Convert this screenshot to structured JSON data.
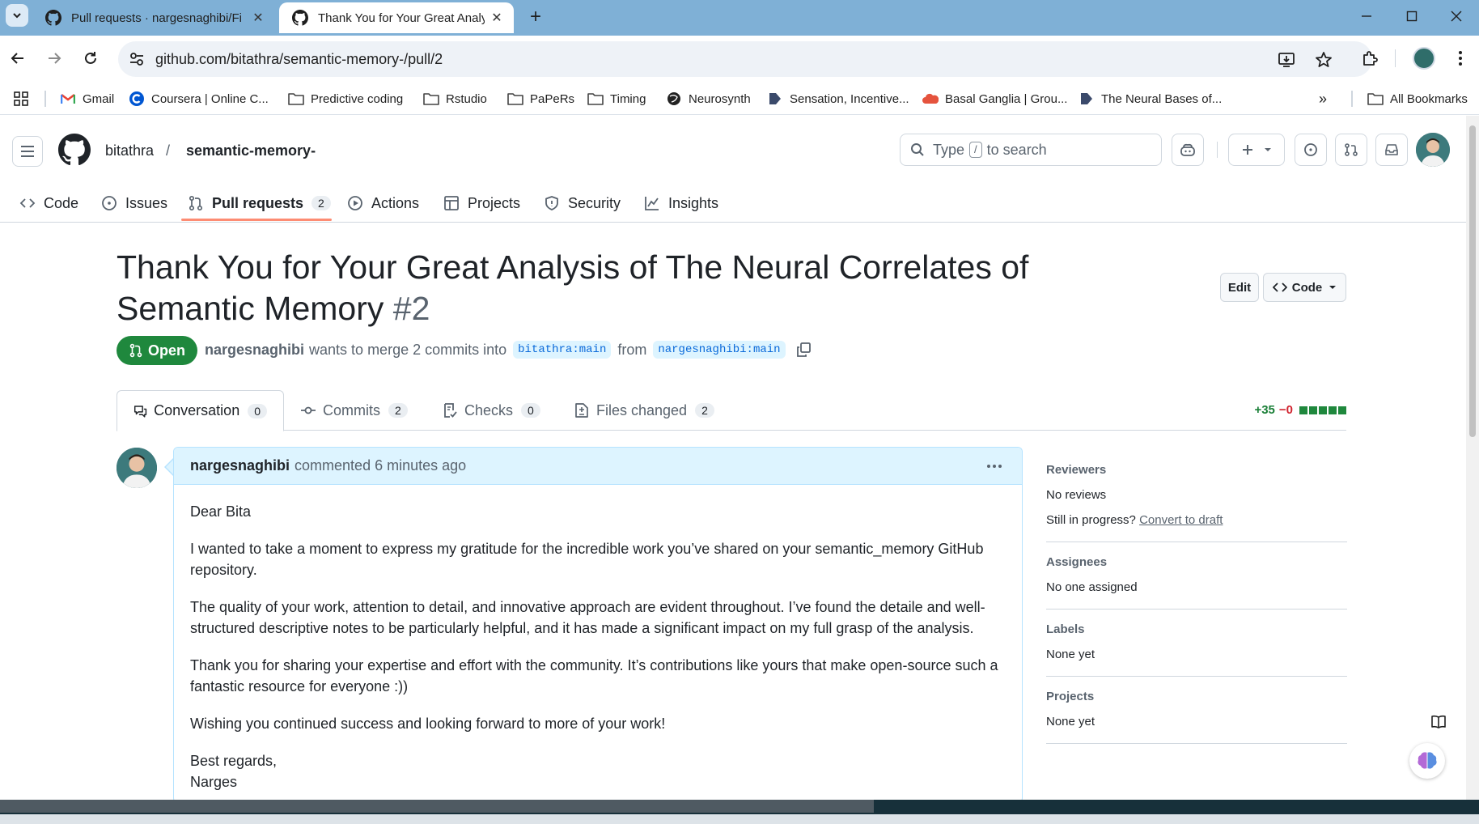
{
  "browser": {
    "tabs": [
      {
        "title": "Pull requests · nargesnaghibi/Fi",
        "active": false
      },
      {
        "title": "Thank You for Your Great Analy",
        "active": true
      }
    ],
    "url": "github.com/bitathra/semantic-memory-/pull/2",
    "bookmarks": [
      {
        "label": "Gmail",
        "icon": "gmail-icon"
      },
      {
        "label": "Coursera | Online C...",
        "icon": "coursera-icon"
      },
      {
        "label": "Predictive coding",
        "icon": "folder-icon"
      },
      {
        "label": "Rstudio",
        "icon": "folder-icon"
      },
      {
        "label": "PaPeRs",
        "icon": "folder-icon"
      },
      {
        "label": "Timing",
        "icon": "folder-icon"
      },
      {
        "label": "Neurosynth",
        "icon": "globe-icon"
      },
      {
        "label": "Sensation, Incentive...",
        "icon": "bookmark-icon"
      },
      {
        "label": "Basal Ganglia | Grou...",
        "icon": "cloud-icon"
      },
      {
        "label": "The Neural Bases of...",
        "icon": "bookmark-icon"
      }
    ],
    "all_bookmarks": "All Bookmarks"
  },
  "github": {
    "owner": "bitathra",
    "repo": "semantic-memory-",
    "search_placeholder_pre": "Type",
    "search_key": "/",
    "search_placeholder_post": "to search",
    "repo_nav": [
      {
        "label": "Code",
        "icon": "code-icon"
      },
      {
        "label": "Issues",
        "icon": "issue-icon"
      },
      {
        "label": "Pull requests",
        "icon": "pull-request-icon",
        "count": "2",
        "selected": true
      },
      {
        "label": "Actions",
        "icon": "play-icon"
      },
      {
        "label": "Projects",
        "icon": "table-icon"
      },
      {
        "label": "Security",
        "icon": "shield-icon"
      },
      {
        "label": "Insights",
        "icon": "graph-icon"
      }
    ]
  },
  "pr": {
    "title": "Thank You for Your Great Analysis of The Neural Correlates of Semantic Memory",
    "number": "#2",
    "state": "Open",
    "edit_label": "Edit",
    "code_label": "Code",
    "author": "nargesnaghibi",
    "merge_text": "wants to merge 2 commits into",
    "base_branch": "bitathra:main",
    "from_text": "from",
    "head_branch": "nargesnaghibi:main",
    "tabs": [
      {
        "label": "Conversation",
        "count": "0",
        "icon": "comment-discussion-icon"
      },
      {
        "label": "Commits",
        "count": "2",
        "icon": "commit-icon"
      },
      {
        "label": "Checks",
        "count": "0",
        "icon": "checklist-icon"
      },
      {
        "label": "Files changed",
        "count": "2",
        "icon": "file-diff-icon"
      }
    ],
    "additions": "+35",
    "deletions": "−0"
  },
  "comment": {
    "author": "nargesnaghibi",
    "meta": "commented 6 minutes ago",
    "paragraphs": [
      "Dear Bita",
      "I wanted to take a moment to express my gratitude for the incredible work you’ve shared on your semantic_memory GitHub repository.",
      "The quality of your work, attention to detail, and innovative approach are evident throughout. I’ve found the detaile and well-structured descriptive notes to be particularly helpful, and it has made a significant impact on my full grasp of the analysis.",
      "Thank you for sharing your expertise and effort with the community. It’s contributions like yours that make open-source such a fantastic resource for everyone :))",
      "Wishing you continued success and looking forward to more of your work!",
      "Best regards,",
      "Narges"
    ]
  },
  "sidebar": {
    "reviewers": {
      "heading": "Reviewers",
      "value": "No reviews",
      "prompt": "Still in progress?",
      "link": "Convert to draft"
    },
    "assignees": {
      "heading": "Assignees",
      "value": "No one assigned"
    },
    "labels": {
      "heading": "Labels",
      "value": "None yet"
    },
    "projects": {
      "heading": "Projects",
      "value": "None yet"
    }
  },
  "colors": {
    "open_green": "#1f883d",
    "link_blue": "#0969da",
    "tab_underline": "#fd8c73",
    "browser_frame": "#7fb0d6"
  }
}
